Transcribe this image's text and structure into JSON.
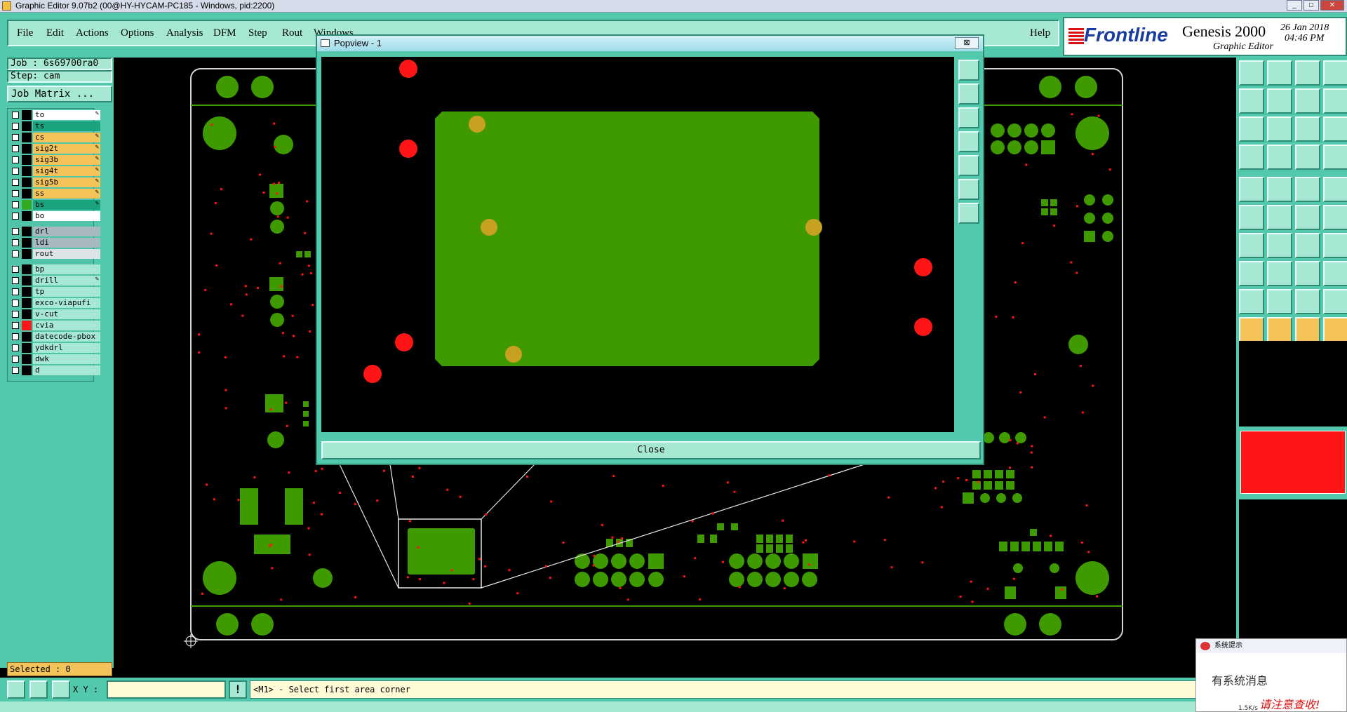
{
  "window": {
    "title": "Graphic Editor 9.07b2 (00@HY-HYCAM-PC185 - Windows, pid:2200)"
  },
  "menu": {
    "items": [
      "File",
      "Edit",
      "Actions",
      "Options",
      "Analysis",
      "DFM",
      "Step",
      "Rout",
      "Windows"
    ],
    "help": "Help"
  },
  "brand": {
    "logo": "Frontline",
    "product": "Genesis 2000",
    "subtitle": "Graphic Editor",
    "date": "26 Jan 2018",
    "time": "04:46 PM"
  },
  "job": {
    "label": "Job : 6s69700ra0",
    "step": "Step: cam",
    "matrix_button": "Job Matrix ..."
  },
  "layers": [
    {
      "name": "to",
      "bg": "#ffffff",
      "swatch": "#000000",
      "editable": true
    },
    {
      "name": "ts",
      "bg": "#1ba37f",
      "swatch": "#000000",
      "editable": false
    },
    {
      "name": "cs",
      "bg": "#f4c45a",
      "swatch": "#000000",
      "editable": true
    },
    {
      "name": "sig2t",
      "bg": "#f4c45a",
      "swatch": "#000000",
      "editable": true
    },
    {
      "name": "sig3b",
      "bg": "#f4c45a",
      "swatch": "#000000",
      "editable": true
    },
    {
      "name": "sig4t",
      "bg": "#f4c45a",
      "swatch": "#000000",
      "editable": true
    },
    {
      "name": "sig5b",
      "bg": "#f4c45a",
      "swatch": "#000000",
      "editable": true
    },
    {
      "name": "ss",
      "bg": "#f4c45a",
      "swatch": "#000000",
      "editable": true
    },
    {
      "name": "bs",
      "bg": "#1ba37f",
      "swatch": "#33aa22",
      "editable": true
    },
    {
      "name": "bo",
      "bg": "#ffffff",
      "swatch": "#000000",
      "editable": false
    },
    {
      "name": "drl",
      "bg": "#a8b8c0",
      "swatch": "#000000",
      "editable": false
    },
    {
      "name": "ldi",
      "bg": "#a8b8c0",
      "swatch": "#000000",
      "editable": false
    },
    {
      "name": "rout",
      "bg": "#dce4e8",
      "swatch": "#000000",
      "editable": false
    },
    {
      "name": "bp",
      "bg": "#a6e8d4",
      "swatch": "#000000",
      "editable": false
    },
    {
      "name": "drill",
      "bg": "#a6e8d4",
      "swatch": "#000000",
      "editable": true
    },
    {
      "name": "tp",
      "bg": "#a6e8d4",
      "swatch": "#000000",
      "editable": false
    },
    {
      "name": "exco-viapufi",
      "bg": "#a6e8d4",
      "swatch": "#000000",
      "editable": false
    },
    {
      "name": "v-cut",
      "bg": "#a6e8d4",
      "swatch": "#000000",
      "editable": false
    },
    {
      "name": "cvia",
      "bg": "#a6e8d4",
      "swatch": "#ff1515",
      "editable": false
    },
    {
      "name": "datecode-pbox",
      "bg": "#a6e8d4",
      "swatch": "#000000",
      "editable": false
    },
    {
      "name": "ydkdrl",
      "bg": "#a6e8d4",
      "swatch": "#000000",
      "editable": false
    },
    {
      "name": "dwk",
      "bg": "#a6e8d4",
      "swatch": "#000000",
      "editable": false
    },
    {
      "name": "d",
      "bg": "#a6e8d4",
      "swatch": "#000000",
      "editable": false
    }
  ],
  "selected": "Selected : 0",
  "coord": {
    "label": "X Y :",
    "value": ""
  },
  "prompt": "<M1> - Select first area corner",
  "popview": {
    "title": "Popview - 1",
    "close_x": "⊠",
    "close": "Close"
  },
  "notify": {
    "title": "系统提示",
    "line1": "有系统消息",
    "line2": "请注意查收!",
    "speed": "1.5K/s"
  },
  "colors": {
    "panel": "#52c9ad",
    "panel_light": "#a6e8d4",
    "pcb_green": "#3f9a00",
    "pad_red": "#ff1515",
    "pad_gold": "#c8a020"
  }
}
